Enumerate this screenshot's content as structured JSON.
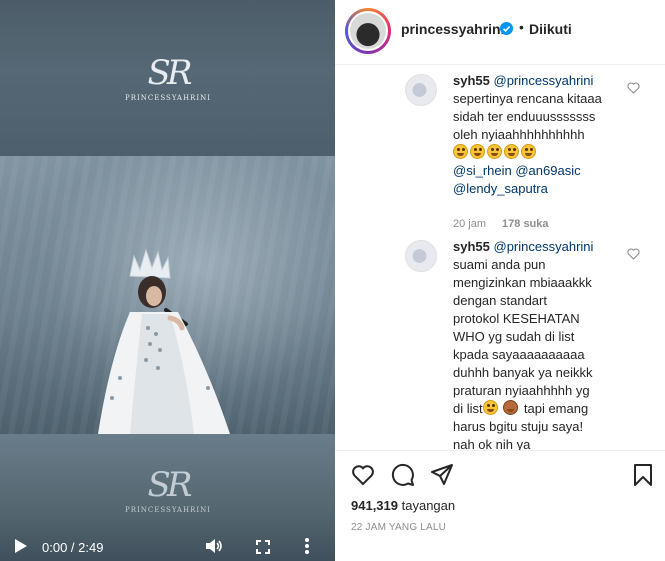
{
  "video": {
    "logo_mark": "SR",
    "logo_text": "PRINCESSYAHRINI",
    "time": "0:00 / 2:49"
  },
  "header": {
    "username": "princessyahrini",
    "separator": "•",
    "follow_label": "Diikuti",
    "verified": true
  },
  "comments": [
    {
      "author": "syh55",
      "lines": [
        "@princessyahrini",
        "sepertinya rencana kitaaa",
        "sidah ter enduuusssssss",
        "oleh nyiaahhhhhhhhhh"
      ],
      "emoji_count": 5,
      "tail_mentions": [
        "@si_rhein",
        "@an69asic",
        "@lendy_saputra"
      ],
      "time": "20 jam",
      "likes": "178 suka"
    },
    {
      "author": "syh55",
      "lines": [
        "@princessyahrini",
        "suami anda pun",
        "mengizinkan mbiaaakkk",
        "dengan standart",
        "protokol KESEHATAN",
        "WHO yg sudah di list",
        "kpada sayaaaaaaaaaa",
        "duhhh banyak ya neikkk",
        "praturan nyiaahhhhh yg",
        "di list",
        "tapi emang",
        "harus bgitu stuju saya!",
        "nah ok nih ya"
      ]
    }
  ],
  "stats": {
    "views_count": "941,319",
    "views_label": "tayangan",
    "posted": "22 JAM YANG LALU"
  },
  "colors": {
    "accent_blue": "#0095f6",
    "mention": "#00376b",
    "meta_gray": "#8e8e8e",
    "text": "#262626"
  }
}
